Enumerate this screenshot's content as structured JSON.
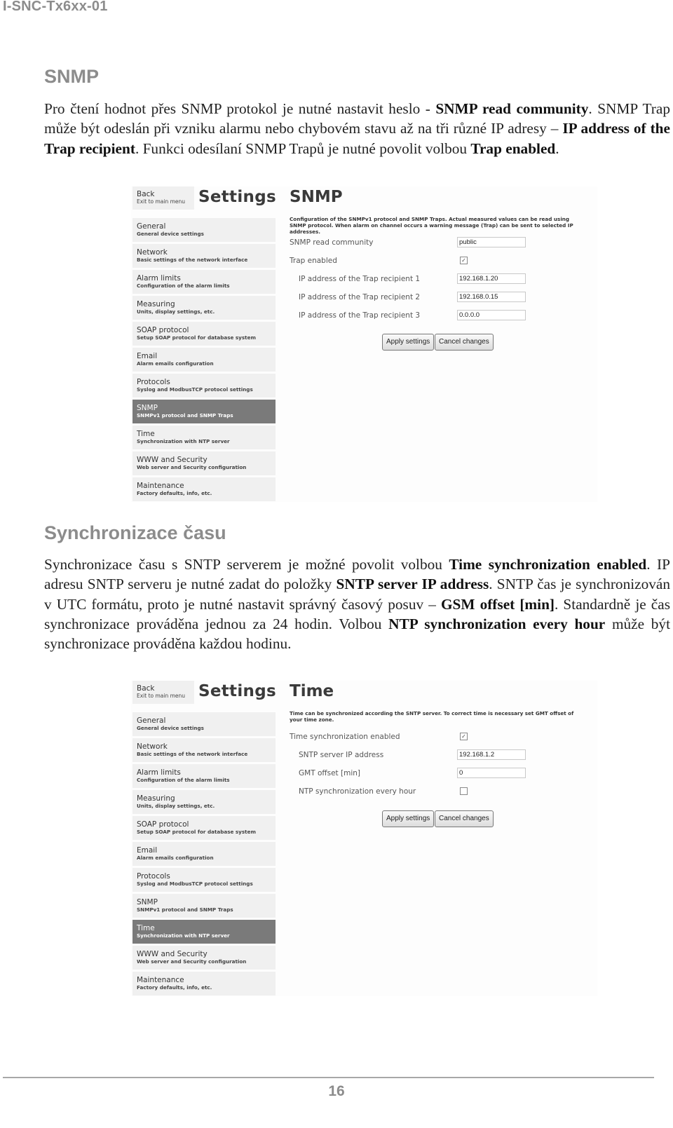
{
  "document": {
    "header": "I-SNC-Tx6xx-01",
    "page_number": "16"
  },
  "snmp_section": {
    "title": "SNMP",
    "paragraph": [
      {
        "text": "Pro čtení hodnot přes SNMP protokol je nutné nastavit heslo - ",
        "bold": false
      },
      {
        "text": "SNMP read community",
        "bold": true
      },
      {
        "text": ". SNMP Trap může být odeslán při vzniku alarmu nebo chybovém stavu až na tři různé IP adresy – ",
        "bold": false
      },
      {
        "text": "IP address of the Trap recipient",
        "bold": true
      },
      {
        "text": ". Funkci odesílaní SNMP Trapů je nutné povolit volbou ",
        "bold": false
      },
      {
        "text": "Trap enabled",
        "bold": true
      },
      {
        "text": ".",
        "bold": false
      }
    ]
  },
  "time_section": {
    "title": "Synchronizace času",
    "paragraph": [
      {
        "text": "Synchronizace času s SNTP serverem je možné povolit volbou ",
        "bold": false
      },
      {
        "text": "Time synchronization enabled",
        "bold": true
      },
      {
        "text": ". IP adresu SNTP serveru je nutné zadat do položky ",
        "bold": false
      },
      {
        "text": "SNTP server IP address",
        "bold": true
      },
      {
        "text": ". SNTP čas je synchronizován v UTC formátu, proto je nutné nastavit správný časový posuv – ",
        "bold": false
      },
      {
        "text": "GSM offset [min]",
        "bold": true
      },
      {
        "text": ". Standardně je čas synchronizace prováděna jednou za 24 hodin. Volbou ",
        "bold": false
      },
      {
        "text": "NTP synchronization every hour",
        "bold": true
      },
      {
        "text": " může být synchronizace prováděna každou hodinu.",
        "bold": false
      }
    ]
  },
  "ui": {
    "back": {
      "title": "Back",
      "subtitle": "Exit to main menu"
    },
    "settings_title": "Settings",
    "nav": [
      {
        "title": "General",
        "subtitle": "General device settings"
      },
      {
        "title": "Network",
        "subtitle": "Basic settings of the network interface"
      },
      {
        "title": "Alarm limits",
        "subtitle": "Configuration of the alarm limits"
      },
      {
        "title": "Measuring",
        "subtitle": "Units, display settings, etc."
      },
      {
        "title": "SOAP protocol",
        "subtitle": "Setup SOAP protocol for database system"
      },
      {
        "title": "Email",
        "subtitle": "Alarm emails configuration"
      },
      {
        "title": "Protocols",
        "subtitle": "Syslog and ModbusTCP protocol settings"
      },
      {
        "title": "SNMP",
        "subtitle": "SNMPv1 protocol and SNMP Traps"
      },
      {
        "title": "Time",
        "subtitle": "Synchronization with NTP server"
      },
      {
        "title": "WWW and Security",
        "subtitle": "Web server and Security configuration"
      },
      {
        "title": "Maintenance",
        "subtitle": "Factory defaults, info, etc."
      }
    ],
    "apply_label": "Apply settings",
    "cancel_label": "Cancel changes"
  },
  "snmp_screenshot": {
    "active_nav": "SNMP",
    "title": "SNMP",
    "description": "Configuration of the SNMPv1 protocol and SNMP Traps. Actual measured values can be read using SNMP protocol. When alarm on channel occurs a warning message (Trap) can be sent to selected IP addresses.",
    "read_community": {
      "label": "SNMP read community",
      "value": "public"
    },
    "trap_enabled": {
      "label": "Trap enabled",
      "checked": true,
      "mark": "✓"
    },
    "recipients": [
      {
        "label": "IP address of the Trap recipient 1",
        "value": "192.168.1.20"
      },
      {
        "label": "IP address of the Trap recipient 2",
        "value": "192.168.0.15"
      },
      {
        "label": "IP address of the Trap recipient 3",
        "value": "0.0.0.0"
      }
    ]
  },
  "time_screenshot": {
    "active_nav": "Time",
    "title": "Time",
    "description": "Time can be synchronized according the SNTP server. To correct time is necessary set GMT offset of your time zone.",
    "sync_enabled": {
      "label": "Time synchronization enabled",
      "checked": true,
      "mark": "✓"
    },
    "sntp_ip": {
      "label": "SNTP server IP address",
      "value": "192.168.1.2"
    },
    "gmt_offset": {
      "label": "GMT offset [min]",
      "value": "0"
    },
    "every_hour": {
      "label": "NTP synchronization every hour",
      "checked": false,
      "mark": ""
    }
  }
}
